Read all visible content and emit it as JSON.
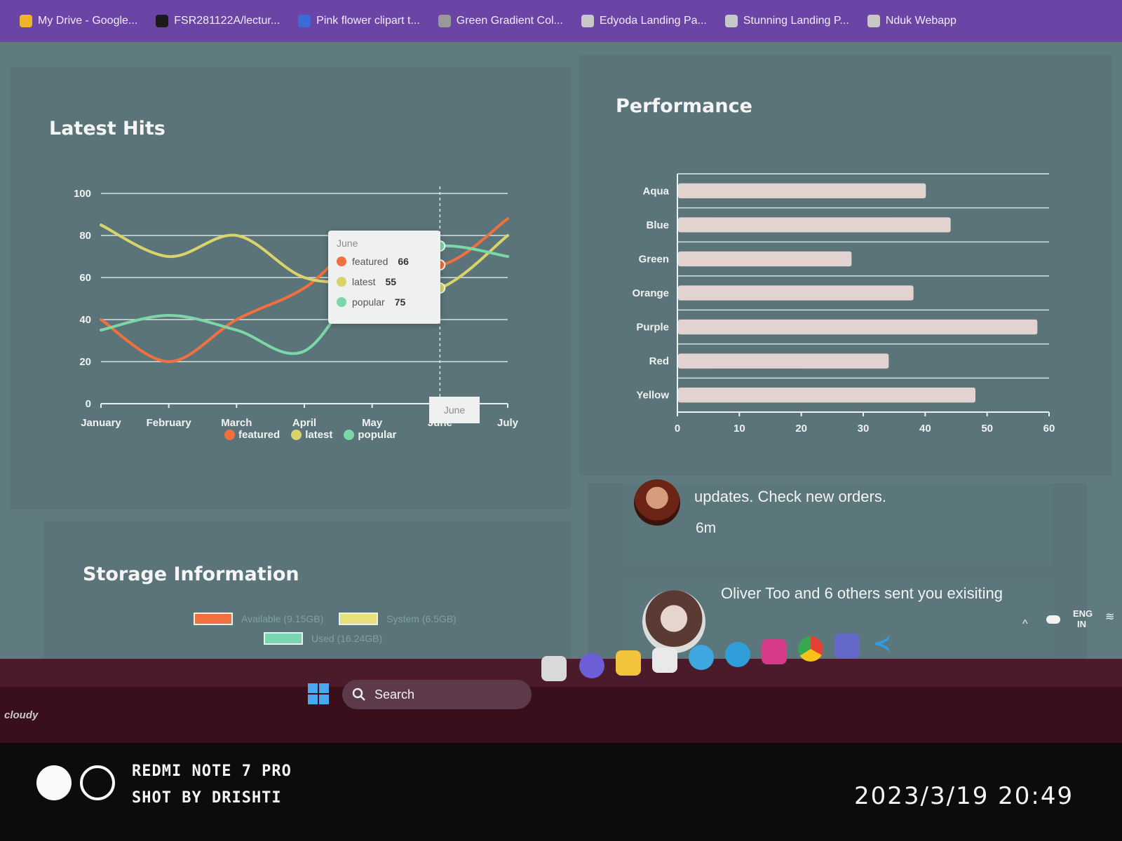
{
  "bookmarks": [
    {
      "label": "My Drive - Google...",
      "icon": "google-drive-icon",
      "color": "#f0b32a"
    },
    {
      "label": "FSR281122A/lectur...",
      "icon": "github-icon",
      "color": "#1b1b1b"
    },
    {
      "label": "Pink flower clipart t...",
      "icon": "bookmark-icon",
      "color": "#3b6bd6"
    },
    {
      "label": "Green Gradient Col...",
      "icon": "bookmark-icon",
      "color": "#999999"
    },
    {
      "label": "Edyoda Landing Pa...",
      "icon": "figma-icon",
      "color": "#c8c8c8"
    },
    {
      "label": "Stunning Landing P...",
      "icon": "figma-icon",
      "color": "#c8c8c8"
    },
    {
      "label": "Nduk Webapp",
      "icon": "figma-icon",
      "color": "#c8c8c8"
    }
  ],
  "latest_hits": {
    "title": "Latest Hits",
    "legend": [
      {
        "name": "featured",
        "color": "#f2703e"
      },
      {
        "name": "latest",
        "color": "#d9d36a"
      },
      {
        "name": "popular",
        "color": "#7bd6a8"
      }
    ],
    "tooltip": {
      "header": "June",
      "rows": [
        {
          "label": "featured",
          "value": "66"
        },
        {
          "label": "latest",
          "value": "55"
        },
        {
          "label": "popular",
          "value": "75"
        }
      ]
    },
    "hover_label": "June"
  },
  "performance": {
    "title": "Performance"
  },
  "storage": {
    "title": "Storage Information",
    "legend": [
      {
        "label": "Available (9.15GB)",
        "color": "#f2703e"
      },
      {
        "label": "System (6.5GB)",
        "color": "#e8e07a"
      },
      {
        "label": "Used (16.24GB)",
        "color": "#7bd6b0"
      }
    ]
  },
  "notifications": [
    {
      "text": "updates. Check new orders.",
      "time": "6m"
    },
    {
      "text": "Oliver Too and 6 others sent you exisiting",
      "time": ""
    }
  ],
  "taskbar": {
    "search_label": "Search",
    "lang_top": "ENG",
    "lang_bottom": "IN",
    "weather": "cloudy"
  },
  "watermark": {
    "line1": "REDMI NOTE 7 PRO",
    "line2": "SHOT BY DRISHTI",
    "datetime": "2023/3/19 20:49"
  },
  "chart_data": [
    {
      "type": "line",
      "categories": [
        "January",
        "February",
        "March",
        "April",
        "May",
        "June",
        "July"
      ],
      "series": [
        {
          "name": "featured",
          "color": "#f2703e",
          "values": [
            40,
            20,
            40,
            55,
            80,
            66,
            88
          ]
        },
        {
          "name": "latest",
          "color": "#d9d36a",
          "values": [
            85,
            70,
            80,
            60,
            58,
            55,
            80
          ]
        },
        {
          "name": "popular",
          "color": "#7bd6a8",
          "values": [
            35,
            42,
            35,
            25,
            65,
            75,
            70
          ]
        }
      ],
      "y_ticks": [
        "0",
        "20",
        "40",
        "60",
        "80",
        "100"
      ],
      "ylim": [
        0,
        100
      ],
      "grid": true,
      "legend_position": "bottom"
    },
    {
      "type": "bar",
      "orientation": "horizontal",
      "categories": [
        "Aqua",
        "Blue",
        "Green",
        "Orange",
        "Purple",
        "Red",
        "Yellow"
      ],
      "values": [
        40,
        44,
        28,
        38,
        58,
        34,
        48
      ],
      "x_ticks": [
        "0",
        "10",
        "20",
        "30",
        "40",
        "50",
        "60"
      ],
      "xlim": [
        0,
        60
      ],
      "grid": true
    }
  ]
}
